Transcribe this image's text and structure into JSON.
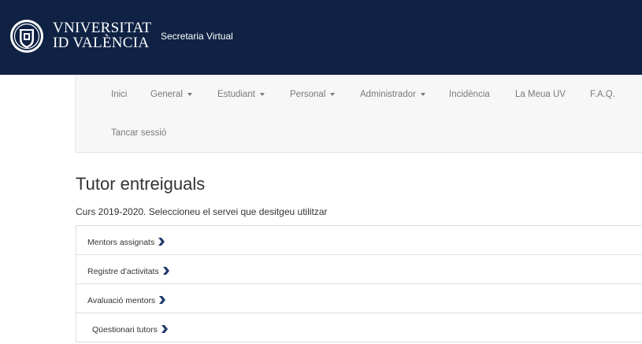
{
  "header": {
    "university_line1": "VNIVERSITAT",
    "university_line2": "ID VALÈNCIA",
    "site_title": "Secretaria Virtual",
    "seal_icon": "university-seal-icon",
    "background": "#0f2244"
  },
  "nav": {
    "items": [
      {
        "label": "Inici"
      },
      {
        "label": "General",
        "dropdown": true
      },
      {
        "label": "Estudiant",
        "dropdown": true
      },
      {
        "label": "Personal",
        "dropdown": true
      },
      {
        "label": "Administrador",
        "dropdown": true
      },
      {
        "label": "Incidència"
      },
      {
        "label": "La Meua UV"
      },
      {
        "label": "F.A.Q."
      },
      {
        "label": "Tancar sessió"
      }
    ]
  },
  "main": {
    "title": "Tutor entreiguals",
    "subtitle": "Curs 2019-2020. Seleccioneu el servei que desitgeu utilitzar",
    "services": [
      {
        "label": "Mentors assignats",
        "icon": "chevron-right-icon"
      },
      {
        "label": "Registre d'activitats",
        "icon": "chevron-right-icon"
      },
      {
        "label": "Avaluació mentors",
        "icon": "chevron-right-icon"
      },
      {
        "label": "Qüestionari tutors",
        "icon": "chevron-right-icon"
      }
    ],
    "accent": "#1f3b6b"
  }
}
